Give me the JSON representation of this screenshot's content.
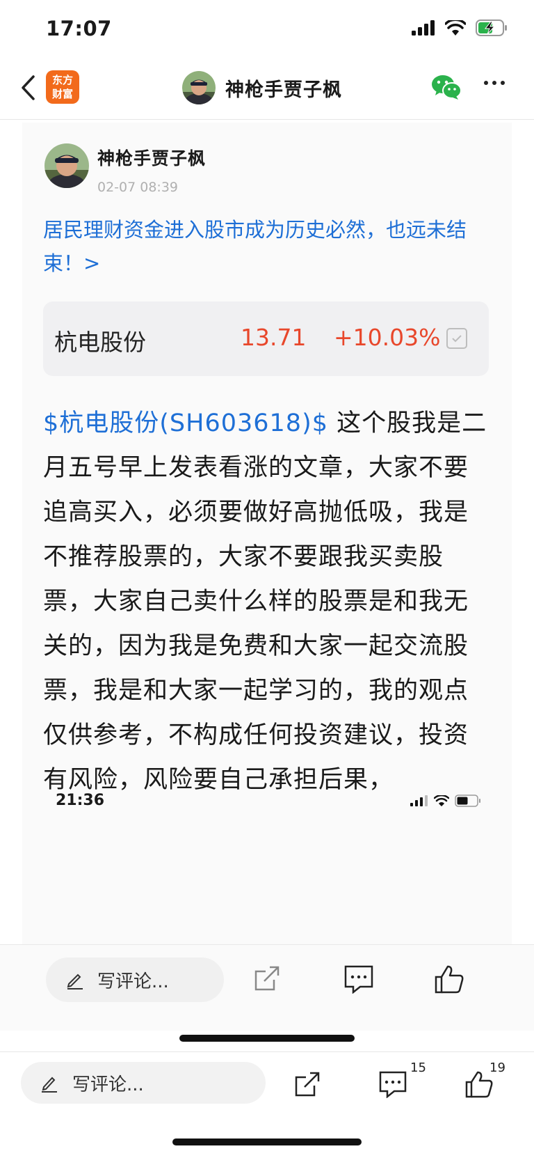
{
  "status_bar": {
    "time": "17:07"
  },
  "nav": {
    "logo_line1": "东方",
    "logo_line2": "财富",
    "title": "神枪手贾子枫"
  },
  "post": {
    "author": "神枪手贾子枫",
    "time": "02-07 08:39",
    "title": "居民理财资金进入股市成为历史必然，也远未结束！>",
    "stock": {
      "name": "杭电股份",
      "price": "13.71",
      "change": "+10.03%"
    },
    "stock_link": "$杭电股份(SH603618)$",
    "body": " 这个股我是二月五号早上发表看涨的文章，大家不要追高买入，必须要做好高抛低吸，我是不推荐股票的，大家不要跟我买卖股票，大家自己卖什么样的股票是和我无关的，因为我是免费和大家一起交流股票，我是和大家一起学习的，我的观点仅供参考，不构成任何投资建议，投资有风险，风险要自己承担后果，"
  },
  "embedded": {
    "status_time": "21:36",
    "comment_placeholder": "写评论..."
  },
  "bottom_bar": {
    "comment_placeholder": "写评论...",
    "comment_count": "15",
    "like_count": "19"
  },
  "colors": {
    "link": "#1e6fd6",
    "rise": "#e8472b",
    "brand": "#f26a1b",
    "wechat": "#2bb24c"
  }
}
